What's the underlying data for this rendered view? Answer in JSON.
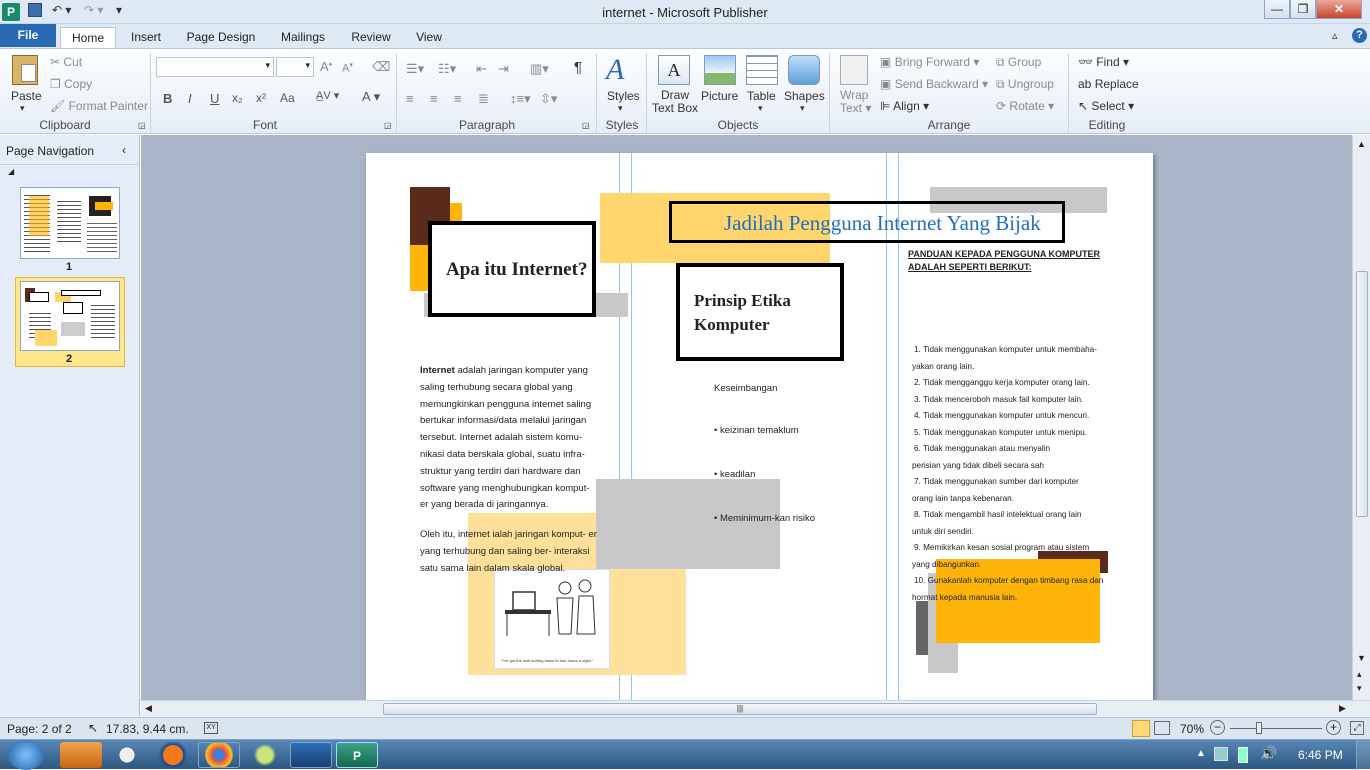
{
  "window": {
    "title": "internet  -  Microsoft Publisher"
  },
  "tabs": [
    "File",
    "Home",
    "Insert",
    "Page Design",
    "Mailings",
    "Review",
    "View"
  ],
  "ribbon": {
    "clipboard": {
      "paste": "Paste",
      "cut": "Cut",
      "copy": "Copy",
      "format_painter": "Format Painter",
      "label": "Clipboard"
    },
    "font": {
      "bold": "B",
      "italic": "I",
      "underline": "U",
      "subscript": "x₂",
      "superscript": "x²",
      "change_case": "Aa",
      "label": "Font"
    },
    "paragraph": {
      "label": "Paragraph",
      "show_marks": "¶"
    },
    "styles": {
      "button": "Styles",
      "label": "Styles"
    },
    "objects": {
      "draw_text_box_1": "Draw",
      "draw_text_box_2": "Text Box",
      "picture": "Picture",
      "table": "Table",
      "shapes": "Shapes",
      "label": "Objects"
    },
    "arrange": {
      "wrap_text_1": "Wrap",
      "wrap_text_2": "Text",
      "bring_forward": "Bring Forward",
      "send_backward": "Send Backward",
      "align": "Align",
      "group": "Group",
      "ungroup": "Ungroup",
      "rotate": "Rotate",
      "label": "Arrange"
    },
    "editing": {
      "find": "Find",
      "replace": "Replace",
      "select": "Select",
      "label": "Editing"
    }
  },
  "page_navigation": {
    "title": "Page Navigation",
    "pages": [
      "1",
      "2"
    ]
  },
  "document": {
    "heading_apa": "Apa itu Internet?",
    "heading_main": "Jadilah Pengguna Internet Yang Bijak",
    "heading_prinsip": "Prinsip Etika Komputer",
    "panduan": "PANDUAN KEPADA PENGGUNA KOMPUTER ADALAH SEPERTI BERIKUT:",
    "intro_bold": "Internet",
    "intro_text": " adalah jaringan komputer yang saling terhubung secara global yang memungkinkan pengguna internet saling bertukar informasi/data melalui jaringan tersebut. Internet adalah sistem komu- nikasi data berskala global, suatu infra- struktur yang terdiri dari hardware dan software yang menghubungkan komput- er yang berada di jaringannya.",
    "para2": "Oleh itu, internet ialah jaringan komput- er yang terhubung dan saling ber- interaksi satu sama lain dalam skala global.",
    "cartoon_caption": "\"I've got the web surfing down to four hours a night.\"",
    "principles": [
      "Keseimbangan",
      "• keizinan temaklum",
      "• keadilan",
      "• Meminimum-kan risiko"
    ],
    "rules": [
      "1.    Tidak menggunakan komputer untuk membaha-",
      "yakan orang lain.",
      "2.    Tidak mengganggu kerja komputer orang lain.",
      "3.    Tidak menceroboh masuk fail komputer lain.",
      "4.    Tidak menggunakan komputer untuk mencuri.",
      "5.    Tidak menggunakan komputer untuk menipu.",
      "6.    Tidak menggunakan atau menyalin",
      "perisian yang tidak dibeli secara sah",
      "7.    Tidak menggunakan sumber dari komputer",
      "orang lain tanpa kebenaran.",
      "8.    Tidak mengambil hasil intelektual orang lain",
      "untuk diri sendiri.",
      "9.    Memikirkan kesan sosial program atau sistem",
      "yang dibangunkan.",
      "10. Gunakanlah komputer dengan timbang rasa dan",
      "hormat kepada manusia lain."
    ]
  },
  "status": {
    "page": "Page: 2 of 2",
    "position": "17.83, 9.44 cm.",
    "zoom": "70%"
  },
  "taskbar": {
    "time": "6:46 PM"
  },
  "colors": {
    "accent": "#2a6ab5",
    "brown": "#5a2a1a",
    "orange": "#ffb40a",
    "light_orange": "#ffd66e",
    "gray": "#c8c8c8",
    "heading_blue": "#1f6fbf"
  }
}
